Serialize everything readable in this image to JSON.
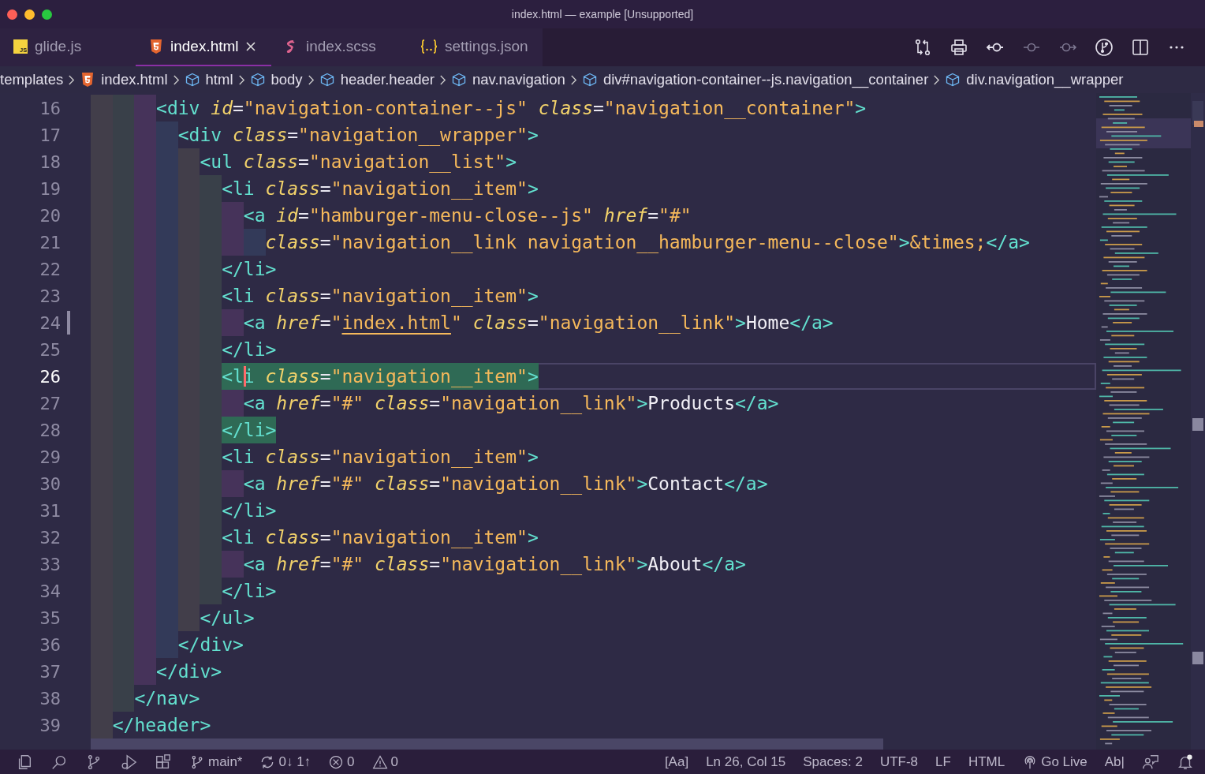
{
  "window": {
    "title": "index.html — example [Unsupported]"
  },
  "tabs": [
    {
      "label": "glide.js",
      "kind": "js",
      "badge": "JS",
      "selected": false
    },
    {
      "label": "index.html",
      "kind": "html",
      "selected": true
    },
    {
      "label": "index.scss",
      "kind": "sass",
      "selected": false
    },
    {
      "label": "settings.json",
      "kind": "json",
      "selected": false
    }
  ],
  "toolbar": [
    {
      "kind": "compare",
      "disabled": false
    },
    {
      "kind": "print",
      "disabled": false
    },
    {
      "kind": "back",
      "disabled": false
    },
    {
      "kind": "commit",
      "disabled": true
    },
    {
      "kind": "forward",
      "disabled": true
    },
    {
      "kind": "graph",
      "disabled": false
    },
    {
      "kind": "split",
      "disabled": false
    },
    {
      "kind": "more",
      "disabled": false
    }
  ],
  "breadcrumbs": [
    {
      "label": "templates",
      "kind": "folder"
    },
    {
      "label": "index.html",
      "kind": "file"
    },
    {
      "label": "html",
      "kind": "element"
    },
    {
      "label": "body",
      "kind": "element"
    },
    {
      "label": "header.header",
      "kind": "element"
    },
    {
      "label": "nav.navigation",
      "kind": "element"
    },
    {
      "label": "div#navigation-container--js.navigation__container",
      "kind": "element"
    },
    {
      "label": "div.navigation__wrapper",
      "kind": "element"
    }
  ],
  "lines": [
    {
      "number": "16",
      "current": false,
      "modified": false,
      "tokens": [
        {
          "kind": "tag",
          "text": "      <div"
        },
        {
          "kind": "attr",
          "text": " id"
        },
        {
          "kind": "punct",
          "text": "="
        },
        {
          "kind": "str",
          "text": "\"navigation-container--js\""
        },
        {
          "kind": "attr",
          "text": " class"
        },
        {
          "kind": "punct",
          "text": "="
        },
        {
          "kind": "str",
          "text": "\"navigation__container\""
        },
        {
          "kind": "tag",
          "text": ">"
        }
      ]
    },
    {
      "number": "17",
      "current": false,
      "modified": false,
      "tokens": [
        {
          "kind": "tag",
          "text": "        <div"
        },
        {
          "kind": "attr",
          "text": " class"
        },
        {
          "kind": "punct",
          "text": "="
        },
        {
          "kind": "str",
          "text": "\"navigation__wrapper\""
        },
        {
          "kind": "tag",
          "text": ">"
        }
      ]
    },
    {
      "number": "18",
      "current": false,
      "modified": false,
      "tokens": [
        {
          "kind": "tag",
          "text": "          <ul"
        },
        {
          "kind": "attr",
          "text": " class"
        },
        {
          "kind": "punct",
          "text": "="
        },
        {
          "kind": "str",
          "text": "\"navigation__list\""
        },
        {
          "kind": "tag",
          "text": ">"
        }
      ]
    },
    {
      "number": "19",
      "current": false,
      "modified": false,
      "tokens": [
        {
          "kind": "tag",
          "text": "            <li"
        },
        {
          "kind": "attr",
          "text": " class"
        },
        {
          "kind": "punct",
          "text": "="
        },
        {
          "kind": "str",
          "text": "\"navigation__item\""
        },
        {
          "kind": "tag",
          "text": ">"
        }
      ]
    },
    {
      "number": "20",
      "current": false,
      "modified": false,
      "tokens": [
        {
          "kind": "tag",
          "text": "              <a"
        },
        {
          "kind": "attr",
          "text": " id"
        },
        {
          "kind": "punct",
          "text": "="
        },
        {
          "kind": "str",
          "text": "\"hamburger-menu-close--js\""
        },
        {
          "kind": "attr",
          "text": " href"
        },
        {
          "kind": "punct",
          "text": "="
        },
        {
          "kind": "str",
          "text": "\"#\""
        }
      ]
    },
    {
      "number": "21",
      "current": false,
      "modified": false,
      "tokens": [
        {
          "kind": "attr",
          "text": "                class"
        },
        {
          "kind": "punct",
          "text": "="
        },
        {
          "kind": "str",
          "text": "\"navigation__link navigation__hamburger-menu--close\""
        },
        {
          "kind": "tag",
          "text": ">"
        },
        {
          "kind": "entity",
          "text": "&times;"
        },
        {
          "kind": "tag",
          "text": "</a>"
        }
      ]
    },
    {
      "number": "22",
      "current": false,
      "modified": false,
      "tokens": [
        {
          "kind": "tag",
          "text": "            </li>"
        }
      ]
    },
    {
      "number": "23",
      "current": false,
      "modified": false,
      "tokens": [
        {
          "kind": "tag",
          "text": "            <li"
        },
        {
          "kind": "attr",
          "text": " class"
        },
        {
          "kind": "punct",
          "text": "="
        },
        {
          "kind": "str",
          "text": "\"navigation__item\""
        },
        {
          "kind": "tag",
          "text": ">"
        }
      ]
    },
    {
      "number": "24",
      "current": false,
      "modified": true,
      "tokens": [
        {
          "kind": "tag",
          "text": "              <a"
        },
        {
          "kind": "attr",
          "text": " href"
        },
        {
          "kind": "punct",
          "text": "="
        },
        {
          "kind": "str",
          "text": "\""
        },
        {
          "kind": "link",
          "text": "index.html"
        },
        {
          "kind": "str",
          "text": "\""
        },
        {
          "kind": "attr",
          "text": " class"
        },
        {
          "kind": "punct",
          "text": "="
        },
        {
          "kind": "str",
          "text": "\"navigation__link\""
        },
        {
          "kind": "tag",
          "text": ">"
        },
        {
          "kind": "text",
          "text": "Home"
        },
        {
          "kind": "tag",
          "text": "</a>"
        }
      ]
    },
    {
      "number": "25",
      "current": false,
      "modified": false,
      "tokens": [
        {
          "kind": "tag",
          "text": "            </li>"
        }
      ]
    },
    {
      "number": "26",
      "current": true,
      "modified": false,
      "matched": true,
      "tokens": [
        {
          "kind": "tag",
          "text": "            <l"
        },
        {
          "kind": "cursor"
        },
        {
          "kind": "tag",
          "text": "i"
        },
        {
          "kind": "attr",
          "text": " class"
        },
        {
          "kind": "punct",
          "text": "="
        },
        {
          "kind": "str",
          "text": "\"navigation__item\""
        },
        {
          "kind": "tag",
          "text": ">"
        }
      ]
    },
    {
      "number": "27",
      "current": false,
      "modified": false,
      "tokens": [
        {
          "kind": "tag",
          "text": "              <a"
        },
        {
          "kind": "attr",
          "text": " href"
        },
        {
          "kind": "punct",
          "text": "="
        },
        {
          "kind": "str",
          "text": "\"#\""
        },
        {
          "kind": "attr",
          "text": " class"
        },
        {
          "kind": "punct",
          "text": "="
        },
        {
          "kind": "str",
          "text": "\"navigation__link\""
        },
        {
          "kind": "tag",
          "text": ">"
        },
        {
          "kind": "text",
          "text": "Products"
        },
        {
          "kind": "tag",
          "text": "</a>"
        }
      ]
    },
    {
      "number": "28",
      "current": false,
      "modified": false,
      "matched": true,
      "tokens": [
        {
          "kind": "tag",
          "text": "            </li>"
        }
      ]
    },
    {
      "number": "29",
      "current": false,
      "modified": false,
      "tokens": [
        {
          "kind": "tag",
          "text": "            <li"
        },
        {
          "kind": "attr",
          "text": " class"
        },
        {
          "kind": "punct",
          "text": "="
        },
        {
          "kind": "str",
          "text": "\"navigation__item\""
        },
        {
          "kind": "tag",
          "text": ">"
        }
      ]
    },
    {
      "number": "30",
      "current": false,
      "modified": false,
      "tokens": [
        {
          "kind": "tag",
          "text": "              <a"
        },
        {
          "kind": "attr",
          "text": " href"
        },
        {
          "kind": "punct",
          "text": "="
        },
        {
          "kind": "str",
          "text": "\"#\""
        },
        {
          "kind": "attr",
          "text": " class"
        },
        {
          "kind": "punct",
          "text": "="
        },
        {
          "kind": "str",
          "text": "\"navigation__link\""
        },
        {
          "kind": "tag",
          "text": ">"
        },
        {
          "kind": "text",
          "text": "Contact"
        },
        {
          "kind": "tag",
          "text": "</a>"
        }
      ]
    },
    {
      "number": "31",
      "current": false,
      "modified": false,
      "tokens": [
        {
          "kind": "tag",
          "text": "            </li>"
        }
      ]
    },
    {
      "number": "32",
      "current": false,
      "modified": false,
      "tokens": [
        {
          "kind": "tag",
          "text": "            <li"
        },
        {
          "kind": "attr",
          "text": " class"
        },
        {
          "kind": "punct",
          "text": "="
        },
        {
          "kind": "str",
          "text": "\"navigation__item\""
        },
        {
          "kind": "tag",
          "text": ">"
        }
      ]
    },
    {
      "number": "33",
      "current": false,
      "modified": false,
      "tokens": [
        {
          "kind": "tag",
          "text": "              <a"
        },
        {
          "kind": "attr",
          "text": " href"
        },
        {
          "kind": "punct",
          "text": "="
        },
        {
          "kind": "str",
          "text": "\"#\""
        },
        {
          "kind": "attr",
          "text": " class"
        },
        {
          "kind": "punct",
          "text": "="
        },
        {
          "kind": "str",
          "text": "\"navigation__link\""
        },
        {
          "kind": "tag",
          "text": ">"
        },
        {
          "kind": "text",
          "text": "About"
        },
        {
          "kind": "tag",
          "text": "</a>"
        }
      ]
    },
    {
      "number": "34",
      "current": false,
      "modified": false,
      "tokens": [
        {
          "kind": "tag",
          "text": "            </li>"
        }
      ]
    },
    {
      "number": "35",
      "current": false,
      "modified": false,
      "tokens": [
        {
          "kind": "tag",
          "text": "          </ul>"
        }
      ]
    },
    {
      "number": "36",
      "current": false,
      "modified": false,
      "tokens": [
        {
          "kind": "tag",
          "text": "        </div>"
        }
      ]
    },
    {
      "number": "37",
      "current": false,
      "modified": false,
      "tokens": [
        {
          "kind": "tag",
          "text": "      </div>"
        }
      ]
    },
    {
      "number": "38",
      "current": false,
      "modified": false,
      "tokens": [
        {
          "kind": "tag",
          "text": "    </nav>"
        }
      ]
    },
    {
      "number": "39",
      "current": false,
      "modified": false,
      "tokens": [
        {
          "kind": "tag",
          "text": "  </header>"
        }
      ]
    }
  ],
  "status_bar": {
    "left": [
      {
        "kind": "branch",
        "label": "main*"
      },
      {
        "kind": "sync",
        "label": "0↓ 1↑"
      },
      {
        "kind": "errors",
        "label": "0"
      },
      {
        "kind": "warnings",
        "label": "0"
      }
    ],
    "right": [
      {
        "kind": "plain",
        "label": "[Aa]"
      },
      {
        "kind": "plain",
        "label": "Ln 26, Col 15"
      },
      {
        "kind": "plain",
        "label": "Spaces: 2"
      },
      {
        "kind": "plain",
        "label": "UTF-8"
      },
      {
        "kind": "plain",
        "label": "LF"
      },
      {
        "kind": "plain",
        "label": "HTML"
      },
      {
        "kind": "live",
        "label": "Go Live"
      },
      {
        "kind": "plain",
        "label": "Ab|"
      }
    ],
    "notifications": true
  }
}
